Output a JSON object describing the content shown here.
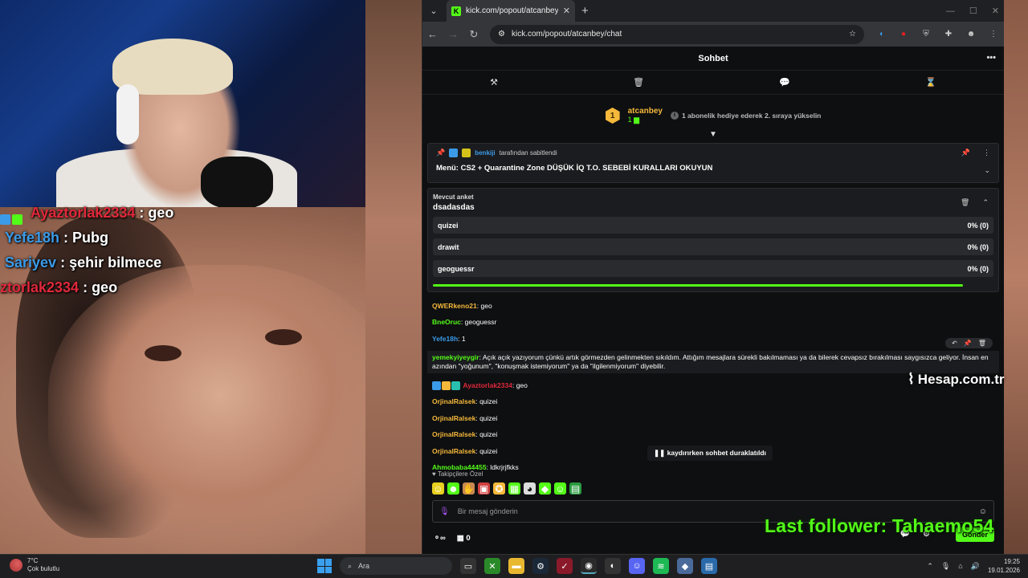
{
  "overlay_chat": [
    {
      "user": "Ayaztorlak2334",
      "sep": " : ",
      "text": "geo",
      "color": "#e0283a"
    },
    {
      "user": "Yefe18h",
      "sep": " : ",
      "text": "Pubg",
      "color": "#3b9be8"
    },
    {
      "user": "Sariyev",
      "sep": " : ",
      "text": "şehir bilmece",
      "color": "#3b9be8"
    },
    {
      "user": "ztorlak2334",
      "sep": " : ",
      "text": "geo",
      "color": "#e0283a"
    }
  ],
  "browser": {
    "tab_title": "kick.com/popout/atcanbey/chat",
    "url": "kick.com/popout/atcanbey/chat"
  },
  "chat": {
    "title": "Sohbet",
    "leader": {
      "rank": "1",
      "name": "atcanbey",
      "sub_count": "1",
      "info": "1 abonelik hediye ederek 2. sıraya yükselin"
    },
    "pinned": {
      "by_user": "benkiji",
      "by_suffix": "tarafından sabitlendi",
      "message": "Menü: CS2 + Quarantine Zone DÜŞÜK İQ T.O. SEBEBİ KURALLARI OKUYUN"
    },
    "poll": {
      "label": "Mevcut anket",
      "title": "dsadasdas",
      "options": [
        {
          "name": "quizei",
          "result": "0% (0)"
        },
        {
          "name": "drawit",
          "result": "0% (0)"
        },
        {
          "name": "geoguessr",
          "result": "0% (0)"
        }
      ]
    },
    "messages": [
      {
        "user": "QWERkeno21",
        "text": "geo",
        "color": "#f5b83a"
      },
      {
        "user": "BneOruc",
        "text": "geoguessr",
        "color": "#53fc18"
      },
      {
        "user": "Yefe18h",
        "text": "1",
        "color": "#3b9be8"
      },
      {
        "user": "yemekyiyeygir",
        "text": "Açık açık yazıyorum çünkü artık görmezden gelinmekten sıkıldım. Attığım mesajlara sürekli bakılmaması ya da bilerek cevapsız bırakılması saygısızca geliyor. İnsan en azından \"yoğunum\", \"konuşmak istemiyorum\" ya da \"ilgilenmiyorum\" diyebilir.",
        "color": "#53fc18"
      },
      {
        "user": "Ayaztorlak2334",
        "text": "geo",
        "color": "#e0283a"
      },
      {
        "user": "OrjinalRalsek",
        "text": "quizei",
        "color": "#f5b83a"
      },
      {
        "user": "OrjinalRalsek",
        "text": "quizei",
        "color": "#f5b83a"
      },
      {
        "user": "OrjinalRalsek",
        "text": "quizei",
        "color": "#f5b83a"
      },
      {
        "user": "OrjinalRalsek",
        "text": "quizei",
        "color": "#f5b83a"
      },
      {
        "user": "Ahmobaba44455",
        "text": "ldkrjrjfkks",
        "color": "#53fc18"
      }
    ],
    "paused_text": "kaydırırken sohbet duraklatıldı",
    "followers_only": "Takipçilere Özel",
    "input_placeholder": "Bir mesaj gönderin",
    "bottom_left_count": "0",
    "send_label": "Gönder"
  },
  "stream_overlays": {
    "hesap": "Hesap.com.tr",
    "last_follower": "Last follower: Tahaemo54"
  },
  "taskbar": {
    "temperature": "7°C",
    "weather": "Çok bulutlu",
    "search": "Ara",
    "time": "19:25",
    "date": "19.01.2026"
  }
}
